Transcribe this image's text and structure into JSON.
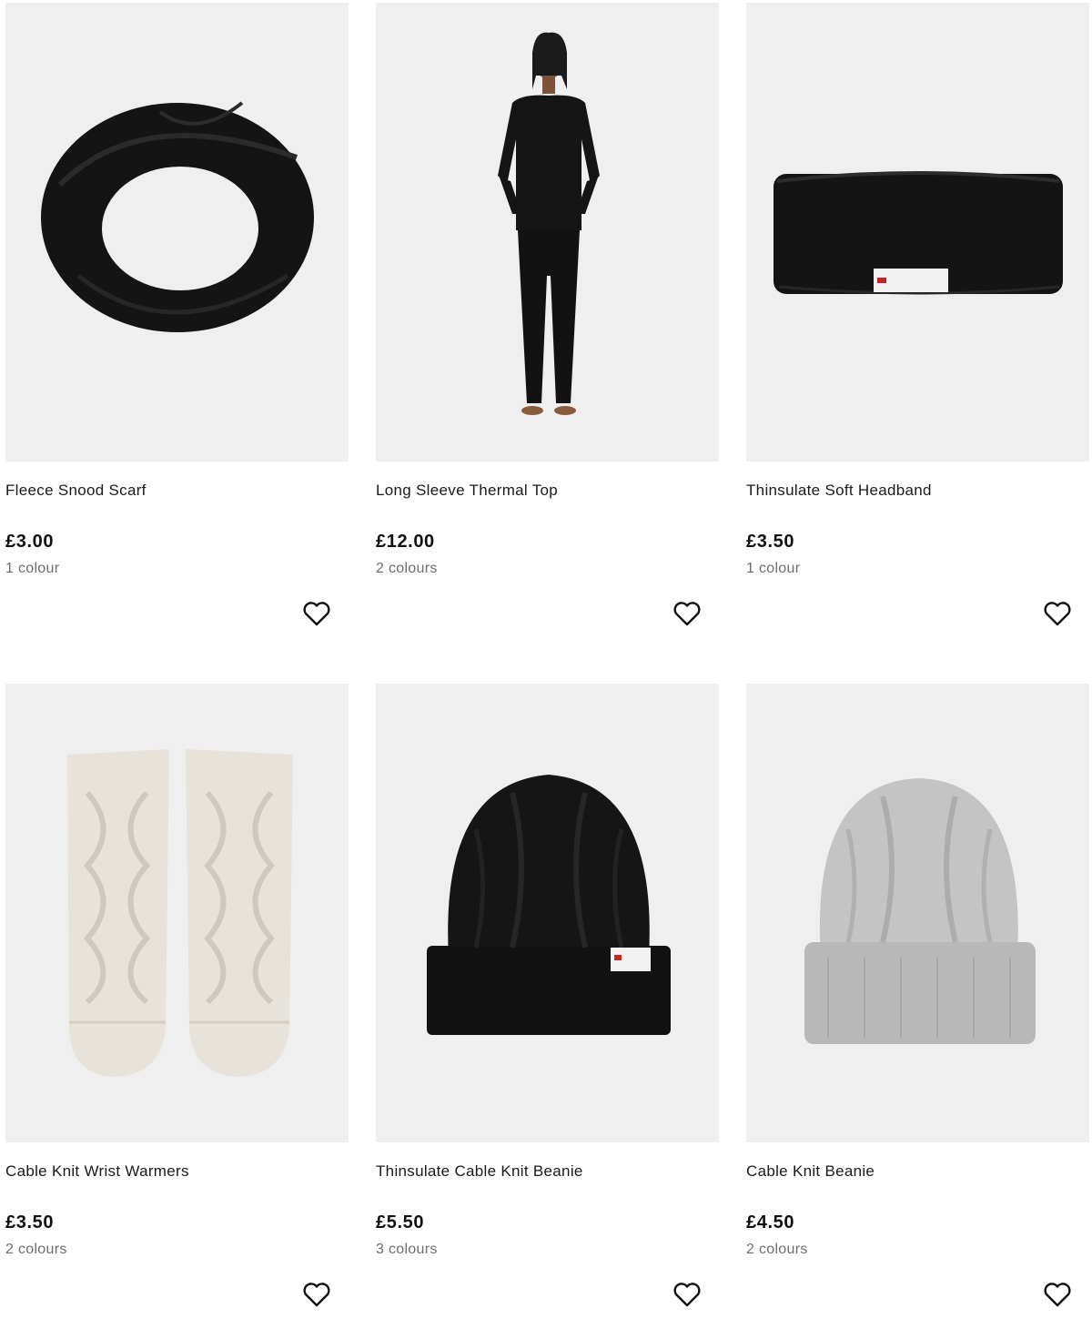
{
  "products": [
    {
      "title": "Fleece Snood Scarf",
      "price": "£3.00",
      "colours": "1 colour",
      "image_icon": "snood-scarf-image"
    },
    {
      "title": "Long Sleeve Thermal Top",
      "price": "£12.00",
      "colours": "2 colours",
      "image_icon": "thermal-top-model-image"
    },
    {
      "title": "Thinsulate Soft Headband",
      "price": "£3.50",
      "colours": "1 colour",
      "image_icon": "headband-image"
    },
    {
      "title": "Cable Knit Wrist Warmers",
      "price": "£3.50",
      "colours": "2 colours",
      "image_icon": "wrist-warmers-image"
    },
    {
      "title": "Thinsulate Cable Knit Beanie",
      "price": "£5.50",
      "colours": "3 colours",
      "image_icon": "black-beanie-image"
    },
    {
      "title": "Cable Knit Beanie",
      "price": "£4.50",
      "colours": "2 colours",
      "image_icon": "grey-beanie-image"
    }
  ],
  "colors": {
    "image_background": "#efefef",
    "text": "#1a1a1a",
    "secondary_text": "#6d6d6d"
  }
}
